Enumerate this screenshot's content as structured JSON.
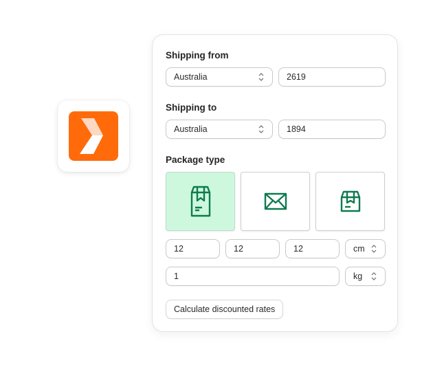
{
  "app_icon": {
    "name": "chevron-logo",
    "brand_color": "#ff6b0a"
  },
  "form": {
    "shipping_from": {
      "label": "Shipping from",
      "country": "Australia",
      "postcode": "2619"
    },
    "shipping_to": {
      "label": "Shipping to",
      "country": "Australia",
      "postcode": "1894"
    },
    "package_type": {
      "label": "Package type",
      "options": [
        {
          "name": "package",
          "icon": "tall-box-icon",
          "selected": true
        },
        {
          "name": "envelope",
          "icon": "envelope-icon",
          "selected": false
        },
        {
          "name": "box",
          "icon": "box-icon",
          "selected": false
        }
      ],
      "accent_color": "#0f7a4f",
      "selected_bg": "#cdf8de"
    },
    "dimensions": {
      "length": "12",
      "width": "12",
      "height": "12",
      "unit": "cm"
    },
    "weight": {
      "value": "1",
      "unit": "kg"
    },
    "submit_label": "Calculate discounted rates"
  }
}
